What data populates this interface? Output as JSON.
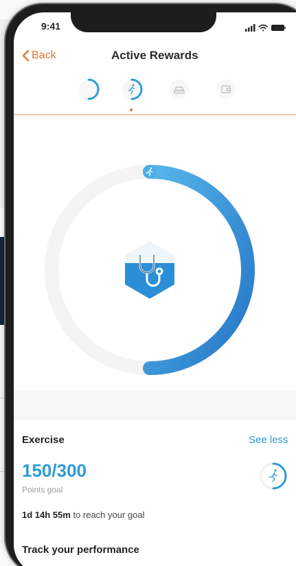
{
  "status_bar": {
    "time": "9:41"
  },
  "nav": {
    "back_label": "Back",
    "title": "Active Rewards"
  },
  "tabs": [
    {
      "icon": "partial-ring-icon",
      "active": false
    },
    {
      "icon": "runner-icon",
      "active": true
    },
    {
      "icon": "car-icon",
      "active": false
    },
    {
      "icon": "wallet-icon",
      "active": false
    }
  ],
  "progress_ring": {
    "progress_fraction": 0.5,
    "center_icon": "stethoscope-icon",
    "marker_icon": "runner-icon"
  },
  "exercise": {
    "title": "Exercise",
    "toggle_label": "See less",
    "points_value": "150/300",
    "points_caption": "Points goal",
    "countdown_strong": "1d 14h 55m",
    "countdown_rest": " to reach your goal",
    "section_heading": "Track your performance"
  },
  "colors": {
    "accent_orange": "#e0782e",
    "accent_blue": "#2f9bd8",
    "ring_track": "#f4f4f4"
  }
}
